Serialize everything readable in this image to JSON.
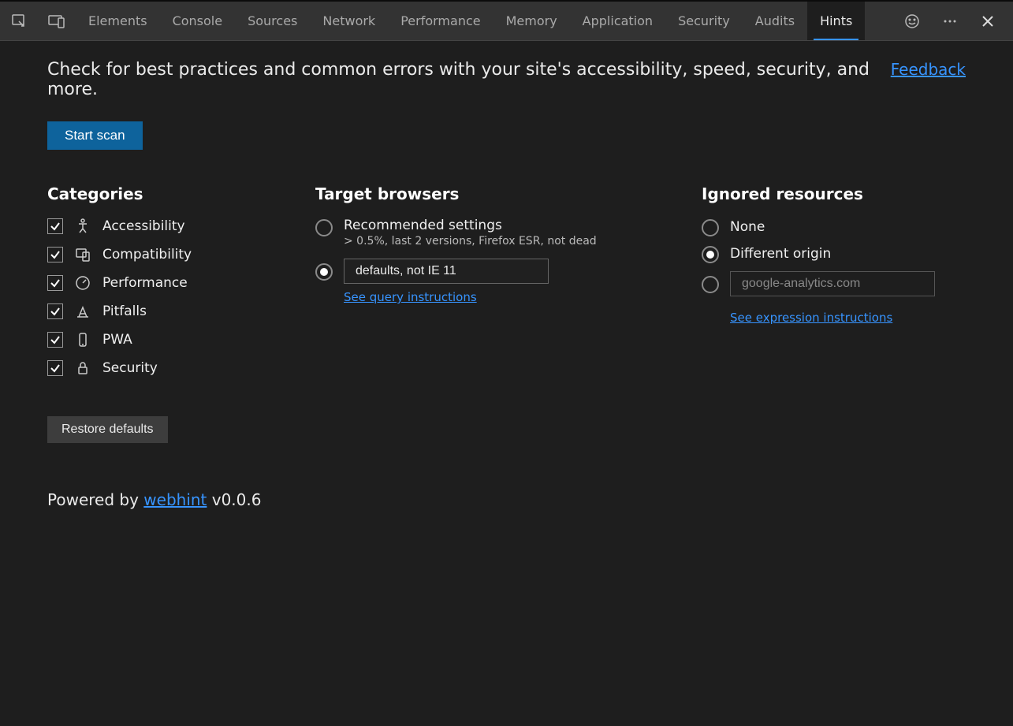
{
  "tabs": [
    "Elements",
    "Console",
    "Sources",
    "Network",
    "Performance",
    "Memory",
    "Application",
    "Security",
    "Audits",
    "Hints"
  ],
  "active_tab": "Hints",
  "tagline": "Check for best practices and common errors with your site's accessibility, speed, security, and more.",
  "feedback": "Feedback",
  "start_scan": "Start scan",
  "categories": {
    "title": "Categories",
    "items": [
      {
        "label": "Accessibility",
        "icon": "accessibility"
      },
      {
        "label": "Compatibility",
        "icon": "compatibility"
      },
      {
        "label": "Performance",
        "icon": "performance"
      },
      {
        "label": "Pitfalls",
        "icon": "pitfalls"
      },
      {
        "label": "PWA",
        "icon": "pwa"
      },
      {
        "label": "Security",
        "icon": "security"
      }
    ],
    "restore": "Restore defaults"
  },
  "target_browsers": {
    "title": "Target browsers",
    "recommended": {
      "label": "Recommended settings",
      "sub": "> 0.5%, last 2 versions, Firefox ESR, not dead"
    },
    "custom_value": "defaults, not IE 11",
    "query_link": "See query instructions"
  },
  "ignored": {
    "title": "Ignored resources",
    "none": "None",
    "diff": "Different origin",
    "placeholder": "google-analytics.com",
    "expr_link": "See expression instructions"
  },
  "footer": {
    "powered_by": "Powered by ",
    "webhint": "webhint",
    "version": " v0.0.6"
  }
}
